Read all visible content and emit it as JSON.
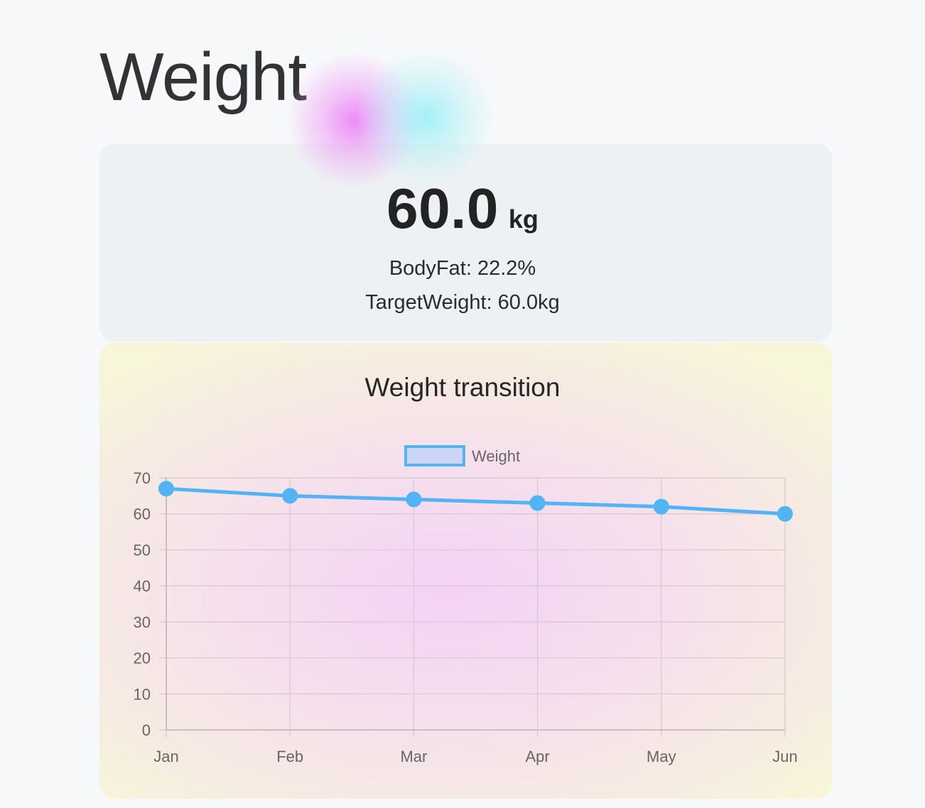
{
  "page": {
    "title": "Weight"
  },
  "summary": {
    "weight_value": "60.0",
    "weight_unit": "kg",
    "body_fat": "BodyFat: 22.2%",
    "target_weight": "TargetWeight: 60.0kg"
  },
  "colors": {
    "series_line": "#53b4f5",
    "series_fill": "#cdd6f6",
    "grid": "#d8c8cf",
    "axis_text": "#666666"
  },
  "chart_data": {
    "type": "line",
    "title": "Weight transition",
    "categories": [
      "Jan",
      "Feb",
      "Mar",
      "Apr",
      "May",
      "Jun"
    ],
    "series": [
      {
        "name": "Weight",
        "values": [
          67,
          65,
          64,
          63,
          62,
          60
        ]
      }
    ],
    "ylim": [
      0,
      70
    ],
    "yticks": [
      0,
      10,
      20,
      30,
      40,
      50,
      60,
      70
    ],
    "grid": true,
    "legend": "top-center"
  }
}
